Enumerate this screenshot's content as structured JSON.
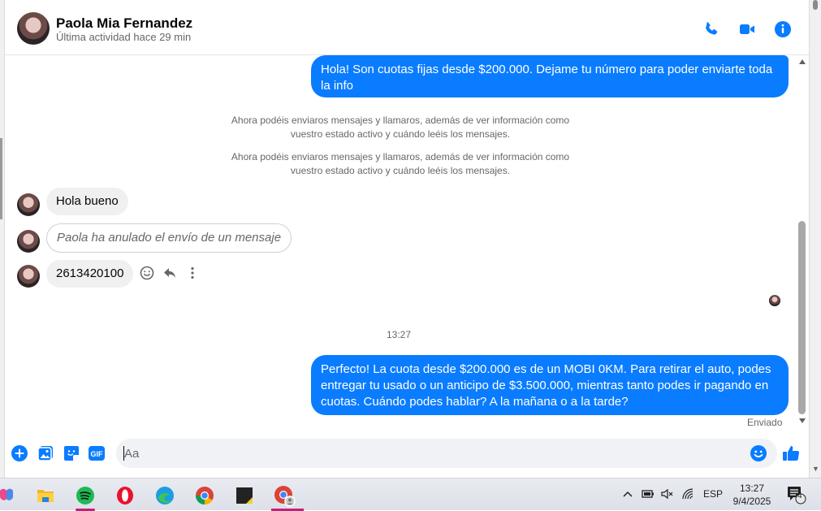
{
  "contact": {
    "name": "Paola Mia Fernandez",
    "status": "Última actividad hace 29 min"
  },
  "header_icons": [
    "phone-icon",
    "video-icon",
    "info-icon"
  ],
  "accent_color": "#0a7cff",
  "messages": {
    "out_1": "Hola! Son cuotas fijas desde $200.000. Dejame tu número para poder enviarte toda la info",
    "system_1": "Ahora podéis enviaros mensajes y llamaros, además de ver información como vuestro estado activo y cuándo leéis los mensajes.",
    "system_2": "Ahora podéis enviaros mensajes y llamaros, además de ver información como vuestro estado activo y cuándo leéis los mensajes.",
    "in_1": "Hola bueno",
    "in_unsent": "Paola ha anulado el envío de un mensaje",
    "in_2": "2613420100",
    "timestamp": "13:27",
    "out_2": "Perfecto! La cuota desde $200.000 es de un MOBI 0KM. Para retirar el auto, podes entregar tu usado o un anticipo de $3.500.000, mientras tanto podes ir pagando en cuotas. Cuándo podes hablar? A la mañana o a la tarde?",
    "delivery_status": "Enviado"
  },
  "composer": {
    "placeholder": "Aa",
    "gif_label": "GIF"
  },
  "taskbar": {
    "apps": [
      "copilot",
      "file-explorer",
      "spotify",
      "opera",
      "edge",
      "chrome",
      "sticky-notes",
      "chrome-profile"
    ],
    "language": "ESP",
    "time": "13:27",
    "date": "9/4/2025",
    "notification_count": "4"
  }
}
